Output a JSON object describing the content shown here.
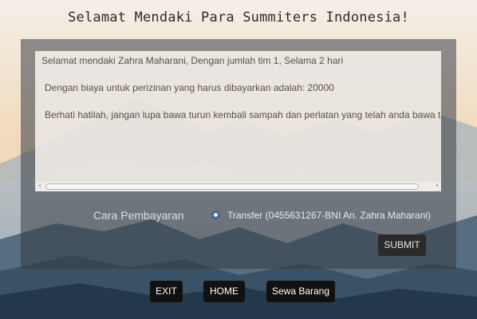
{
  "header": {
    "title": "Selamat Mendaki Para Summiters Indonesia!"
  },
  "output": {
    "lines": [
      "Selamat mendaki Zahra Maharani, Dengan jumlah tim 1, Selama 2 hari",
      "Dengan biaya untuk perizinan yang harus dibayarkan adalah: 20000",
      "Berhati hatilah, jangan lupa bawa turun kembali sampah dan perlatan yang telah anda bawa ta"
    ]
  },
  "scrollbar": {
    "left_arrow": "‹",
    "right_arrow": "›"
  },
  "payment": {
    "label": "Cara Pembayaran",
    "option_label": "Transfer (0455631267-BNI An. Zahra Maharani)",
    "option_selected": true
  },
  "buttons": {
    "submit": "SUBMIT",
    "exit": "EXIT",
    "home": "HOME",
    "sewa": "Sewa Barang"
  },
  "colors": {
    "sky_top": "#f3ede4",
    "sky_mid": "#f0d7b9",
    "mountain_dark": "#1f3446",
    "button_bg": "#111111"
  }
}
